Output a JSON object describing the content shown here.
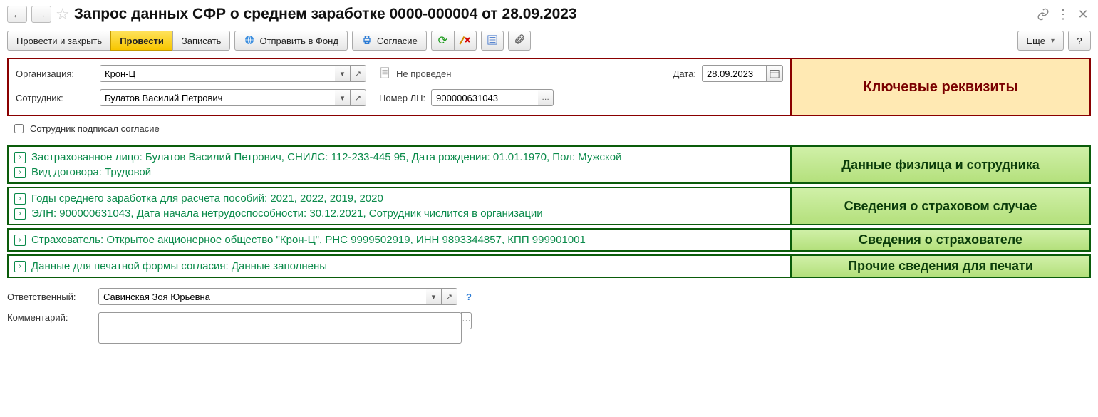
{
  "header": {
    "title": "Запрос данных СФР о среднем заработке 0000-000004 от 28.09.2023"
  },
  "toolbar": {
    "post_and_close": "Провести и закрыть",
    "post": "Провести",
    "write": "Записать",
    "send_to_fund": "Отправить в Фонд",
    "consent": "Согласие",
    "more": "Еще"
  },
  "requisites": {
    "title": "Ключевые реквизиты",
    "org_label": "Организация:",
    "org_value": "Крон-Ц",
    "status": "Не проведен",
    "date_label": "Дата:",
    "date_value": "28.09.2023",
    "employee_label": "Сотрудник:",
    "employee_value": "Булатов Василий Петрович",
    "ln_label": "Номер ЛН:",
    "ln_value": "900000631043"
  },
  "consent_checkbox": "Сотрудник подписал согласие",
  "panels": [
    {
      "title": "Данные физлица и сотрудника",
      "lines": [
        "Застрахованное лицо: Булатов Василий Петрович, СНИЛС: 112-233-445 95, Дата рождения: 01.01.1970, Пол: Мужской",
        "Вид договора: Трудовой"
      ]
    },
    {
      "title": "Сведения о страховом случае",
      "lines": [
        "Годы среднего заработка для расчета пособий: 2021, 2022, 2019, 2020",
        "ЭЛН: 900000631043, Дата начала нетрудоспособности: 30.12.2021, Сотрудник числится в организации"
      ]
    },
    {
      "title": "Сведения о страхователе",
      "lines": [
        "Страхователь: Открытое акционерное общество \"Крон-Ц\", РНС 9999502919, ИНН 9893344857, КПП 999901001"
      ]
    },
    {
      "title": "Прочие сведения для печати",
      "lines": [
        "Данные для печатной формы согласия: Данные заполнены"
      ]
    }
  ],
  "footer": {
    "responsible_label": "Ответственный:",
    "responsible_value": "Савинская Зоя Юрьевна",
    "comment_label": "Комментарий:",
    "comment_value": ""
  }
}
